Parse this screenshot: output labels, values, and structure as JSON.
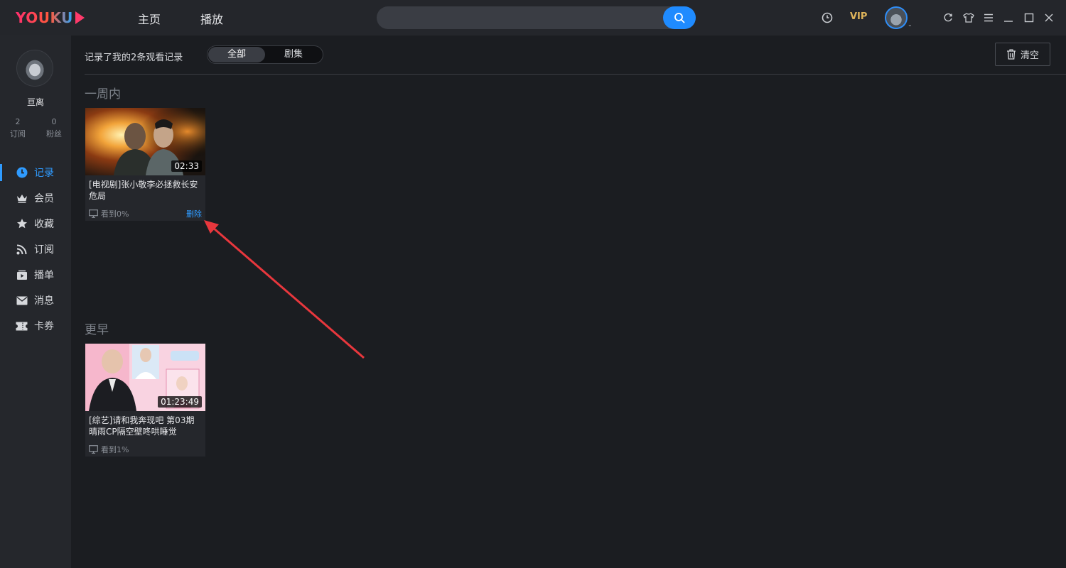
{
  "app": {
    "logo": "YOUKU",
    "brand_color": "#ff3a6b",
    "accent": "#1f8bff"
  },
  "topbar": {
    "nav": [
      "主页",
      "播放"
    ],
    "search": {
      "value": "",
      "placeholder": ""
    },
    "vip_label": "VIP"
  },
  "sidebar": {
    "username": "亘离",
    "stats": [
      {
        "count": "2",
        "label": "订阅"
      },
      {
        "count": "0",
        "label": "粉丝"
      }
    ],
    "items": [
      {
        "label": "记录",
        "icon": "clock-icon",
        "active": true
      },
      {
        "label": "会员",
        "icon": "crown-icon"
      },
      {
        "label": "收藏",
        "icon": "star-icon"
      },
      {
        "label": "订阅",
        "icon": "rss-icon"
      },
      {
        "label": "播单",
        "icon": "playlist-icon"
      },
      {
        "label": "消息",
        "icon": "mail-icon"
      },
      {
        "label": "卡券",
        "icon": "ticket-icon"
      }
    ]
  },
  "main": {
    "summary": "记录了我的2条观看记录",
    "filters": [
      "全部",
      "剧集"
    ],
    "clear_label": "清空",
    "sections": [
      {
        "title": "一周内",
        "videos": [
          {
            "title": "[电视剧]张小敬李必拯救长安危局",
            "duration": "02:33",
            "progress": "看到0%",
            "delete_label": "删除"
          }
        ]
      },
      {
        "title": "更早",
        "videos": [
          {
            "title": "[综艺]请和我奔现吧 第03期 晴雨CP隔空壁咚哄睡觉",
            "duration": "01:23:49",
            "progress": "看到1%"
          }
        ]
      }
    ]
  }
}
